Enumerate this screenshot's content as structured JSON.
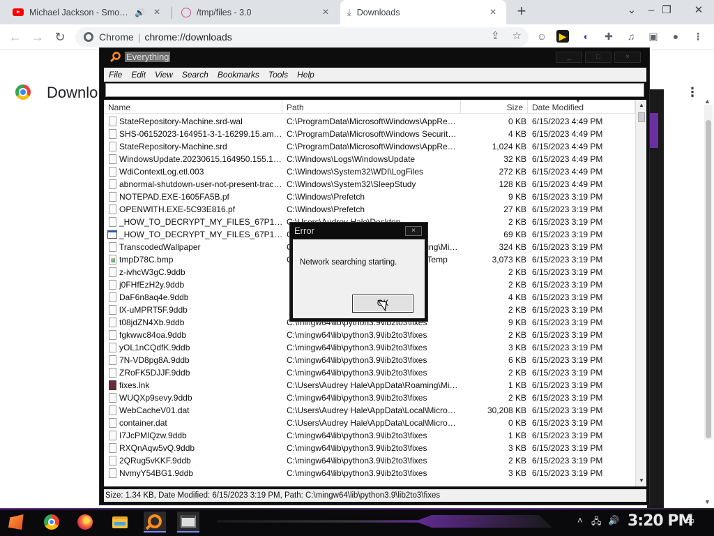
{
  "browser": {
    "tabs": [
      {
        "title": "Michael Jackson - Smooth",
        "icon": "youtube-icon",
        "audio": true
      },
      {
        "title": "/tmp/files - 3.0",
        "icon": "globe-icon"
      },
      {
        "title": "Downloads",
        "icon": "download-icon",
        "active": true
      }
    ],
    "omnibox": {
      "site": "Chrome",
      "url": "chrome://downloads"
    },
    "page_title": "Downlo"
  },
  "everything": {
    "title": "Everything",
    "menu": [
      "File",
      "Edit",
      "View",
      "Search",
      "Bookmarks",
      "Tools",
      "Help"
    ],
    "search_value": "",
    "columns": {
      "name": "Name",
      "path": "Path",
      "size": "Size",
      "date": "Date Modified"
    },
    "rows": [
      {
        "name": "StateRepository-Machine.srd-wal",
        "path": "C:\\ProgramData\\Microsoft\\Windows\\AppRepository",
        "size": "0 KB",
        "date": "6/15/2023 4:49 PM",
        "icon": "file"
      },
      {
        "name": "SHS-06152023-164951-3-1-16299.15.amd64f...",
        "path": "C:\\ProgramData\\Microsoft\\Windows Security Heal...",
        "size": "4 KB",
        "date": "6/15/2023 4:49 PM",
        "icon": "file"
      },
      {
        "name": "StateRepository-Machine.srd",
        "path": "C:\\ProgramData\\Microsoft\\Windows\\AppRepository",
        "size": "1,024 KB",
        "date": "6/15/2023 4:49 PM",
        "icon": "file"
      },
      {
        "name": "WindowsUpdate.20230615.164950.155.1.etl",
        "path": "C:\\Windows\\Logs\\WindowsUpdate",
        "size": "32 KB",
        "date": "6/15/2023 4:49 PM",
        "icon": "file"
      },
      {
        "name": "WdiContextLog.etl.003",
        "path": "C:\\Windows\\System32\\WDI\\LogFiles",
        "size": "272 KB",
        "date": "6/15/2023 4:49 PM",
        "icon": "file"
      },
      {
        "name": "abnormal-shutdown-user-not-present-trace-2...",
        "path": "C:\\Windows\\System32\\SleepStudy",
        "size": "128 KB",
        "date": "6/15/2023 4:49 PM",
        "icon": "file"
      },
      {
        "name": "NOTEPAD.EXE-1605FA5B.pf",
        "path": "C:\\Windows\\Prefetch",
        "size": "9 KB",
        "date": "6/15/2023 3:19 PM",
        "icon": "file"
      },
      {
        "name": "OPENWITH.EXE-5C93E816.pf",
        "path": "C:\\Windows\\Prefetch",
        "size": "27 KB",
        "date": "6/15/2023 3:19 PM",
        "icon": "file"
      },
      {
        "name": "_HOW_TO_DECRYPT_MY_FILES_67P1994H_.txt",
        "path": "C:\\Users\\Audrey Hale\\Desktop",
        "size": "2 KB",
        "date": "6/15/2023 3:19 PM",
        "icon": "file"
      },
      {
        "name": "_HOW_TO_DECRYPT_MY_FILES_67P1994H_.hta",
        "path": "C:\\Users\\Audrey Hale\\Desktop",
        "size": "69 KB",
        "date": "6/15/2023 3:19 PM",
        "icon": "hta"
      },
      {
        "name": "TranscodedWallpaper",
        "path": "C:\\Users\\Audrey Hale\\AppData\\Roaming\\Micros...",
        "size": "324 KB",
        "date": "6/15/2023 3:19 PM",
        "icon": "file"
      },
      {
        "name": "tmpD78C.bmp",
        "path": "C:\\Users\\Audrey Hale\\AppData\\Local\\Temp",
        "size": "3,073 KB",
        "date": "6/15/2023 3:19 PM",
        "icon": "bmp"
      },
      {
        "name": "z-ivhcW3gC.9ddb",
        "path": "",
        "size": "2 KB",
        "date": "6/15/2023 3:19 PM",
        "icon": "file"
      },
      {
        "name": "j0FHfEzH2y.9ddb",
        "path": "",
        "size": "2 KB",
        "date": "6/15/2023 3:19 PM",
        "icon": "file"
      },
      {
        "name": "DaF6n8aq4e.9ddb",
        "path": "",
        "size": "4 KB",
        "date": "6/15/2023 3:19 PM",
        "icon": "file"
      },
      {
        "name": "lX-uMPRT5F.9ddb",
        "path": "",
        "size": "2 KB",
        "date": "6/15/2023 3:19 PM",
        "icon": "file"
      },
      {
        "name": "t08jdZN4Xb.9ddb",
        "path": "C:\\mingw64\\lib\\python3.9\\lib2to3\\fixes",
        "size": "9 KB",
        "date": "6/15/2023 3:19 PM",
        "icon": "file"
      },
      {
        "name": "fgkwwc84oa.9ddb",
        "path": "C:\\mingw64\\lib\\python3.9\\lib2to3\\fixes",
        "size": "2 KB",
        "date": "6/15/2023 3:19 PM",
        "icon": "file"
      },
      {
        "name": "yOL1nCQdfK.9ddb",
        "path": "C:\\mingw64\\lib\\python3.9\\lib2to3\\fixes",
        "size": "3 KB",
        "date": "6/15/2023 3:19 PM",
        "icon": "file"
      },
      {
        "name": "7N-VD8pg8A.9ddb",
        "path": "C:\\mingw64\\lib\\python3.9\\lib2to3\\fixes",
        "size": "6 KB",
        "date": "6/15/2023 3:19 PM",
        "icon": "file"
      },
      {
        "name": "ZRoFK5DJJF.9ddb",
        "path": "C:\\mingw64\\lib\\python3.9\\lib2to3\\fixes",
        "size": "2 KB",
        "date": "6/15/2023 3:19 PM",
        "icon": "file"
      },
      {
        "name": "fixes.lnk",
        "path": "C:\\Users\\Audrey Hale\\AppData\\Roaming\\Micros...",
        "size": "1 KB",
        "date": "6/15/2023 3:19 PM",
        "icon": "lnk"
      },
      {
        "name": "WUQXp9sevy.9ddb",
        "path": "C:\\mingw64\\lib\\python3.9\\lib2to3\\fixes",
        "size": "2 KB",
        "date": "6/15/2023 3:19 PM",
        "icon": "file"
      },
      {
        "name": "WebCacheV01.dat",
        "path": "C:\\Users\\Audrey Hale\\AppData\\Local\\Microsoft\\...",
        "size": "30,208 KB",
        "date": "6/15/2023 3:19 PM",
        "icon": "file"
      },
      {
        "name": "container.dat",
        "path": "C:\\Users\\Audrey Hale\\AppData\\Local\\Microsoft\\...",
        "size": "0 KB",
        "date": "6/15/2023 3:19 PM",
        "icon": "file"
      },
      {
        "name": "I7JcPMIQzw.9ddb",
        "path": "C:\\mingw64\\lib\\python3.9\\lib2to3\\fixes",
        "size": "1 KB",
        "date": "6/15/2023 3:19 PM",
        "icon": "file"
      },
      {
        "name": "RXQnAqw5vQ.9ddb",
        "path": "C:\\mingw64\\lib\\python3.9\\lib2to3\\fixes",
        "size": "3 KB",
        "date": "6/15/2023 3:19 PM",
        "icon": "file"
      },
      {
        "name": "2QRug5vKKF.9ddb",
        "path": "C:\\mingw64\\lib\\python3.9\\lib2to3\\fixes",
        "size": "2 KB",
        "date": "6/15/2023 3:19 PM",
        "icon": "file"
      },
      {
        "name": "NvmyY54BG1.9ddb",
        "path": "C:\\mingw64\\lib\\python3.9\\lib2to3\\fixes",
        "size": "3 KB",
        "date": "6/15/2023 3:19 PM",
        "icon": "file"
      }
    ],
    "status": "Size: 1.34 KB, Date Modified: 6/15/2023 3:19 PM, Path: C:\\mingw64\\lib\\python3.9\\lib2to3\\fixes"
  },
  "dialog": {
    "title": "Error",
    "message": "Network searching starting.",
    "ok_label": "OK"
  },
  "taskbar": {
    "clock": "3:20 PM",
    "items": [
      "start-icon",
      "chrome-icon",
      "firefox-icon",
      "file-explorer-icon",
      "everything-icon",
      "app-icon"
    ]
  }
}
